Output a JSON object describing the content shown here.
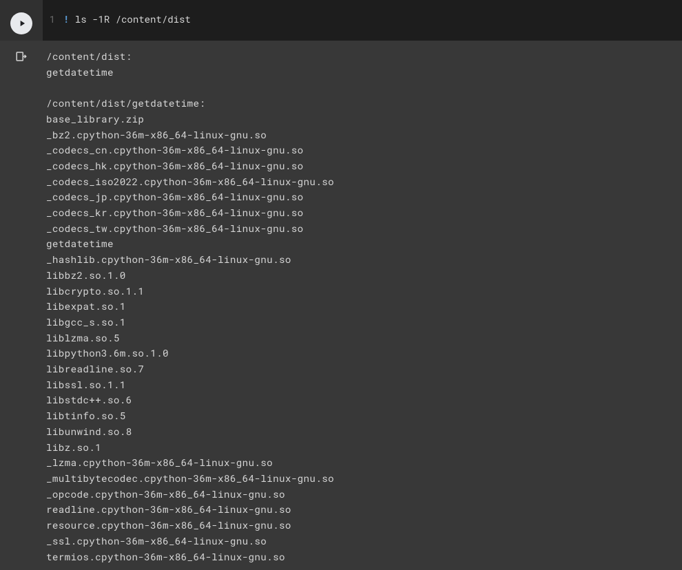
{
  "code": {
    "line_number": "1",
    "bang": "!",
    "command": " ls -1R /content/dist"
  },
  "output": {
    "lines": [
      "/content/dist:",
      "getdatetime",
      "",
      "/content/dist/getdatetime:",
      "base_library.zip",
      "_bz2.cpython-36m-x86_64-linux-gnu.so",
      "_codecs_cn.cpython-36m-x86_64-linux-gnu.so",
      "_codecs_hk.cpython-36m-x86_64-linux-gnu.so",
      "_codecs_iso2022.cpython-36m-x86_64-linux-gnu.so",
      "_codecs_jp.cpython-36m-x86_64-linux-gnu.so",
      "_codecs_kr.cpython-36m-x86_64-linux-gnu.so",
      "_codecs_tw.cpython-36m-x86_64-linux-gnu.so",
      "getdatetime",
      "_hashlib.cpython-36m-x86_64-linux-gnu.so",
      "libbz2.so.1.0",
      "libcrypto.so.1.1",
      "libexpat.so.1",
      "libgcc_s.so.1",
      "liblzma.so.5",
      "libpython3.6m.so.1.0",
      "libreadline.so.7",
      "libssl.so.1.1",
      "libstdc++.so.6",
      "libtinfo.so.5",
      "libunwind.so.8",
      "libz.so.1",
      "_lzma.cpython-36m-x86_64-linux-gnu.so",
      "_multibytecodec.cpython-36m-x86_64-linux-gnu.so",
      "_opcode.cpython-36m-x86_64-linux-gnu.so",
      "readline.cpython-36m-x86_64-linux-gnu.so",
      "resource.cpython-36m-x86_64-linux-gnu.so",
      "_ssl.cpython-36m-x86_64-linux-gnu.so",
      "termios.cpython-36m-x86_64-linux-gnu.so"
    ]
  }
}
